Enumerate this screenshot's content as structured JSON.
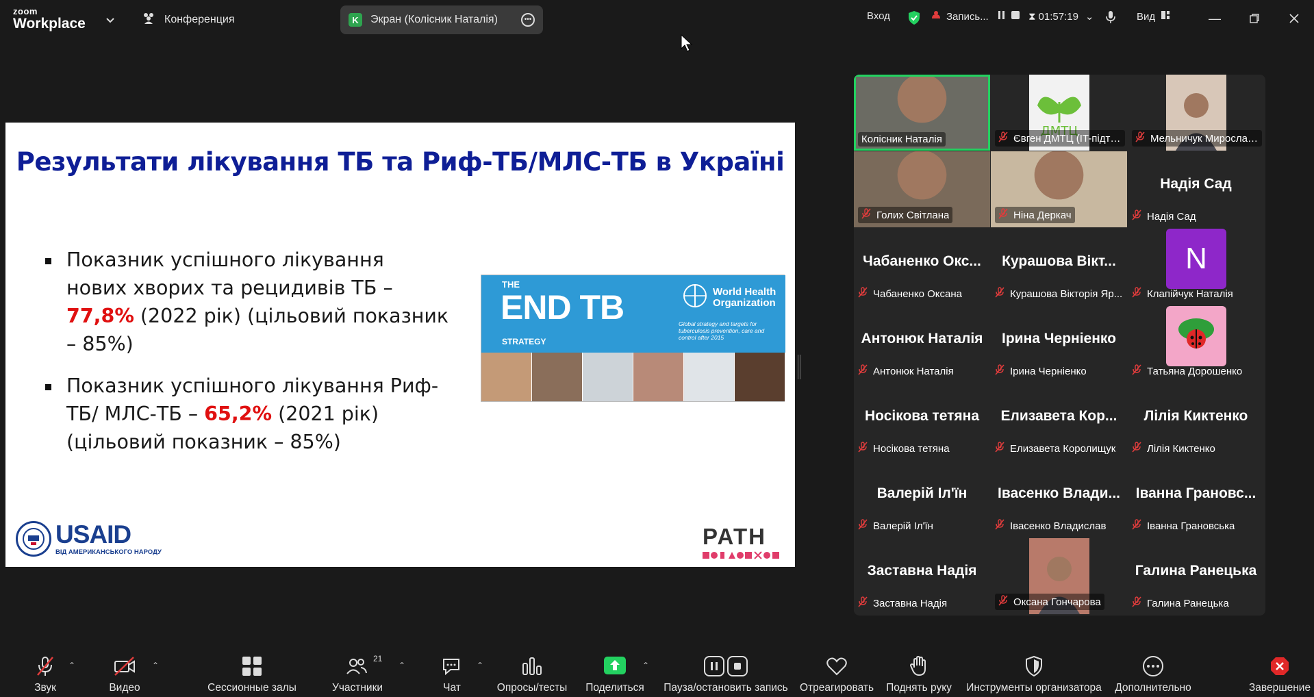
{
  "app": {
    "brand_top": "zoom",
    "brand_bottom": "Workplace"
  },
  "topbar": {
    "conference_label": "Конференция",
    "screen_share_label": "Экран (Колісник Наталія)",
    "screen_share_initial": "K",
    "login_label": "Вход",
    "recording_label": "Запись...",
    "timer": "01:57:19",
    "view_label": "Вид"
  },
  "slide": {
    "title": "Результати лікування ТБ та Риф-ТБ/МЛС-ТБ в Україні",
    "bullets": [
      {
        "before": "Показник успішного лікування нових хворих та рецидивів ТБ – ",
        "highlight": "77,8%",
        "after": " (2022 рік) (цільовий показник – 85%)"
      },
      {
        "before": "Показник успішного лікування Риф-ТБ/ МЛС-ТБ – ",
        "highlight": "65,2%",
        "after": " (2021 рік) (цільовий показник – 85%)"
      }
    ],
    "endtb": {
      "the": "THE",
      "end": "END",
      "tb": "TB",
      "strategy": "STRATEGY",
      "who_line1": "World Health",
      "who_line2": "Organization",
      "tagline": "Global strategy and targets for tuberculosis prevention, care and control after 2015"
    },
    "usaid": {
      "word": "USAID",
      "sub": "ВІД АМЕРИКАНСЬКОГО НАРОДУ"
    },
    "path": {
      "word": "PATH"
    },
    "colors": {
      "title": "#0e1e96",
      "highlight": "#e01010"
    }
  },
  "participants": [
    {
      "big": "",
      "name": "Колісник Наталія",
      "muted": false,
      "video": true,
      "active": true
    },
    {
      "big": "",
      "name": "Євген ДМТЦ (IT-підтр...",
      "muted": true,
      "video": true,
      "logo": "ДМТЦ"
    },
    {
      "big": "",
      "name": "Мельничук Мирослава",
      "muted": true,
      "video": true
    },
    {
      "big": "",
      "name": "Голих Світлана",
      "muted": true,
      "video": true
    },
    {
      "big": "",
      "name": "Ніна Деркач",
      "muted": true,
      "video": true
    },
    {
      "big": "Надія Сад",
      "name": "Надія Сад",
      "muted": true
    },
    {
      "big": "Чабаненко Окс...",
      "name": "Чабаненко Оксана",
      "muted": true
    },
    {
      "big": "Курашова Вікт...",
      "name": "Курашова Вікторія Яр...",
      "muted": true
    },
    {
      "big": "",
      "name": "Клапійчук Наталія",
      "muted": true,
      "avatar": "N"
    },
    {
      "big": "Антонюк Наталія",
      "name": "Антонюк Наталія",
      "muted": true
    },
    {
      "big": "Ірина Черніенко",
      "name": "Ірина Черніенко",
      "muted": true
    },
    {
      "big": "",
      "name": "Татьяна Дорошенко",
      "muted": true,
      "ladybug": true
    },
    {
      "big": "Носікова тетяна",
      "name": "Носікова тетяна",
      "muted": true
    },
    {
      "big": "Елизавета Кор...",
      "name": "Елизавета Королищук",
      "muted": true
    },
    {
      "big": "Лілія Киктенко",
      "name": "Лілія Киктенко",
      "muted": true
    },
    {
      "big": "Валерій Іл'їн",
      "name": "Валерій Іл'їн",
      "muted": true
    },
    {
      "big": "Івасенко Влади...",
      "name": "Івасенко Владислав",
      "muted": true
    },
    {
      "big": "Іванна Грановс...",
      "name": "Іванна Грановська",
      "muted": true
    },
    {
      "big": "Заставна Надія",
      "name": "Заставна Надія",
      "muted": true
    },
    {
      "big": "",
      "name": "Оксана Гончарова",
      "muted": true,
      "video": true,
      "narrow": true
    },
    {
      "big": "Галина Ранецька",
      "name": "Галина Ранецька",
      "muted": true
    }
  ],
  "toolbar": {
    "audio": "Звук",
    "video": "Видео",
    "breakout": "Сессионные залы",
    "participants": "Участники",
    "participants_count": "21",
    "chat": "Чат",
    "polls": "Опросы/тесты",
    "share": "Поделиться",
    "pause_record": "Пауза/остановить запись",
    "react": "Отреагировать",
    "raise_hand": "Поднять руку",
    "host_tools": "Инструменты организатора",
    "more": "Дополнительно",
    "end": "Завершение"
  },
  "icons": [
    "chevron-down-icon",
    "conference-icon",
    "more-icon",
    "shield-icon",
    "record-icon",
    "pause-icon",
    "stop-icon",
    "hourglass-icon",
    "mic-icon",
    "view-icon",
    "minimize-icon",
    "restore-icon",
    "close-icon",
    "mic-muted-icon",
    "video-off-icon",
    "grid-icon",
    "participants-icon",
    "chat-icon",
    "polls-icon",
    "share-arrow-icon",
    "heart-icon",
    "hand-icon",
    "host-shield-icon",
    "ellipsis-icon",
    "end-icon"
  ]
}
